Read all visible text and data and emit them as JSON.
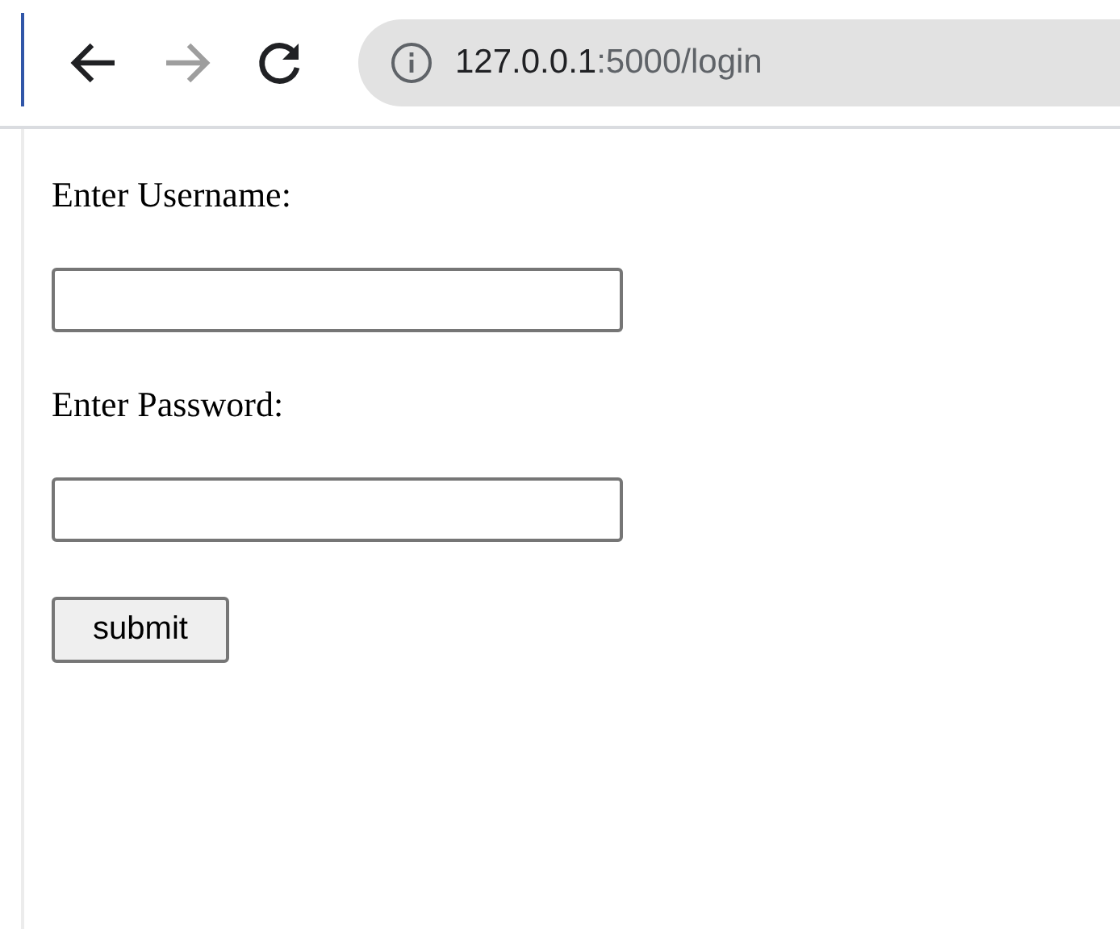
{
  "toolbar": {
    "back": {
      "disabled": false
    },
    "forward": {
      "disabled": true
    },
    "url": {
      "host": "127.0.0.1",
      "path": ":5000/login"
    }
  },
  "form": {
    "fields": [
      {
        "label": "Enter Username:"
      },
      {
        "label": "Enter Password:"
      }
    ],
    "submit": "submit"
  }
}
